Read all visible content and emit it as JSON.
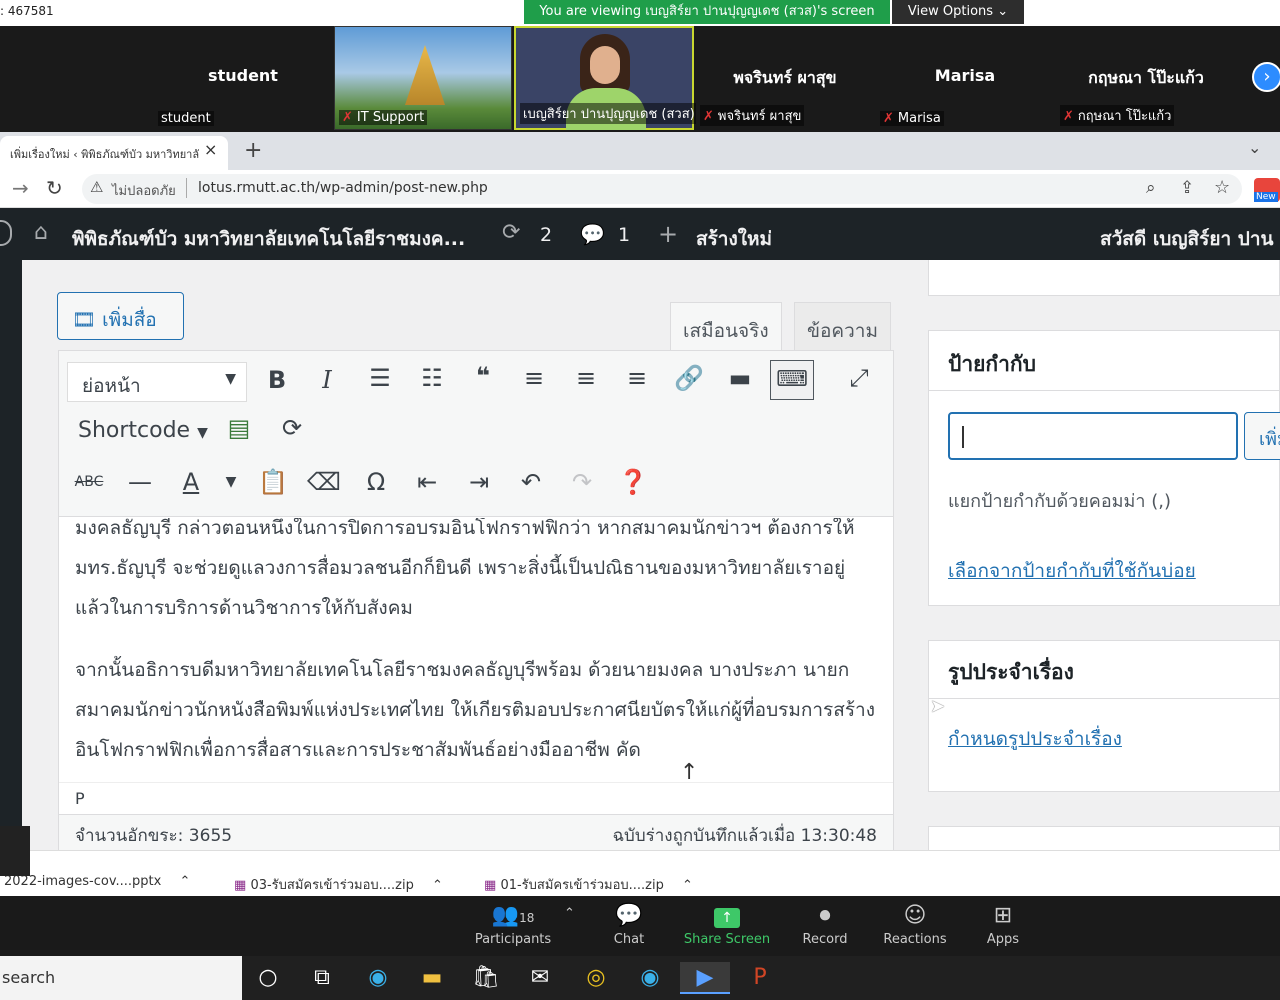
{
  "zoom": {
    "meeting_id": ": 467581",
    "viewing_text": "You are viewing เบญสิร์ยา ปานปุญญเดช (สวส)'s screen",
    "view_options": "View Options",
    "participants_tiles": [
      {
        "name": "student",
        "caption": "student"
      },
      {
        "name": "",
        "caption": "IT Support"
      },
      {
        "name": "",
        "caption": "เบญสิร์ยา ปานปุญญเดช (สวส)"
      },
      {
        "name": "พจรินทร์ ผาสุข",
        "caption": "พจรินทร์ ผาสุข"
      },
      {
        "name": "Marisa",
        "caption": "Marisa"
      },
      {
        "name": "กฤษณา โป๊ะแก้ว",
        "caption": "กฤษณา โป๊ะแก้ว"
      }
    ],
    "controls": {
      "participants_label": "Participants",
      "participants_count": "18",
      "chat_label": "Chat",
      "share_label": "Share Screen",
      "record_label": "Record",
      "reactions_label": "Reactions",
      "apps_label": "Apps"
    }
  },
  "browser": {
    "tab_title": "เพิ่มเรื่องใหม่ ‹ พิพิธภัณฑ์บัว มหาวิทยาลั",
    "insecure_label": "ไม่ปลอดภัย",
    "url": "lotus.rmutt.ac.th/wp-admin/post-new.php",
    "new_badge": "New"
  },
  "wp_admin_bar": {
    "site_name": "พิพิธภัณฑ์บัว มหาวิทยาลัยเทคโนโลยีราชมงค...",
    "updates_count": "2",
    "comments_count": "1",
    "new_label": "สร้างใหม่",
    "greeting": "สวัสดี เบญสิร์ยา ปาน"
  },
  "editor": {
    "add_media_label": "เพิ่มสื่อ",
    "tab_visual": "เสมือนจริง",
    "tab_text": "ข้อความ",
    "format_select": "ย่อหน้า",
    "shortcode_label": "Shortcode",
    "paragraphs": [
      "มงคลธัญบุรี กล่าวตอนหนึ่งในการปิดการอบรมอินโฟกราฟฟิกว่า หากสมาคมนักข่าวฯ ต้องการให้ มทร.ธัญบุรี จะช่วยดูแลวงการสื่อมวลชนอีกก็ยินดี เพราะสิ่งนี้เป็นปณิธานของมหาวิทยาลัยเราอยู่แล้วในการบริการด้านวิชาการให้กับสังคม",
      "จากนั้นอธิการบดีมหาวิทยาลัยเทคโนโลยีราชมงคลธัญบุรีพร้อม ด้วยนายมงคล บางประภา นายกสมาคมนักข่าวนักหนังสือพิมพ์แห่งประเทศไทย ให้เกียรติมอบประกาศนียบัตรให้แก่ผู้ที่อบรมการสร้างอินโฟกราฟฟิกเพื่อการสื่อสารและการประชาสัมพันธ์อย่างมืออาชีพ คัด"
    ],
    "path": "P",
    "word_count": "จำนวนอักขระ: 3655",
    "draft_saved": "ฉบับร่างถูกบันทึกแล้วเมื่อ 13:30:48"
  },
  "sidebar_boxes": {
    "tags_title": "ป้ายกำกับ",
    "tags_input_value": "",
    "add_tag_button": "เพิ่ม",
    "tags_hint": "แยกป้ายกำกับด้วยคอมม่า (,)",
    "tags_choose_link": "เลือกจากป้ายกำกับที่ใช้กันบ่อย",
    "featured_title": "รูปประจำเรื่อง",
    "featured_link": "กำหนดรูปประจำเรื่อง"
  },
  "downloads": [
    "2022-images-cov....pptx",
    "03-รับสมัครเข้าร่วมอบ....zip",
    "01-รับสมัครเข้าร่วมอบ....zip"
  ],
  "taskbar": {
    "search_text": "search"
  }
}
